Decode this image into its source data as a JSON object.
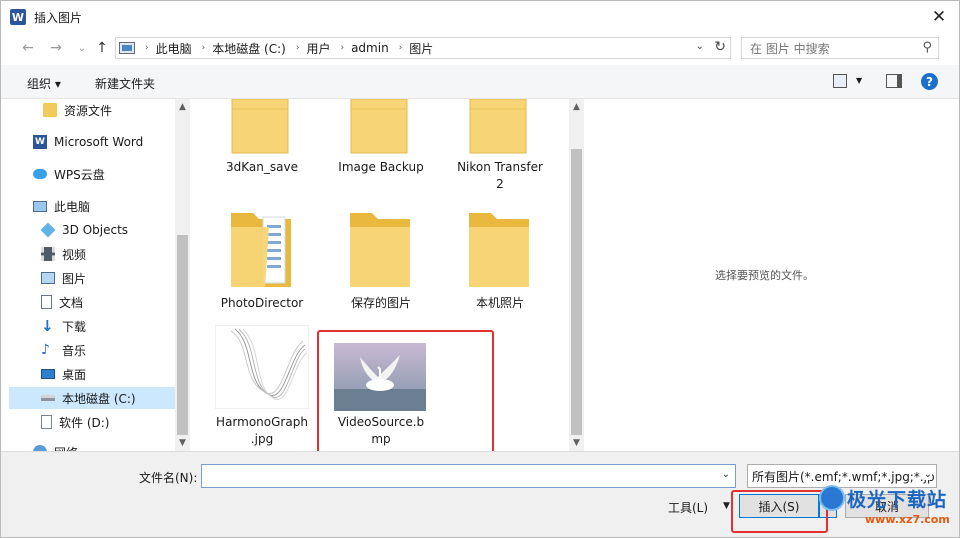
{
  "window": {
    "title": "插入图片",
    "app_icon_letter": "W"
  },
  "address": {
    "crumbs": [
      "此电脑",
      "本地磁盘 (C:)",
      "用户",
      "admin",
      "图片"
    ],
    "search_placeholder": "在 图片 中搜索"
  },
  "toolbar": {
    "organize": "组织 ▾",
    "new_folder": "新建文件夹"
  },
  "sidebar": {
    "items": [
      {
        "label": "资源文件",
        "icon": "folder-icon"
      },
      {
        "label": "Microsoft Word",
        "icon": "word-icon"
      },
      {
        "label": "WPS云盘",
        "icon": "cloud-icon"
      },
      {
        "label": "此电脑",
        "icon": "computer-icon"
      },
      {
        "label": "3D Objects",
        "icon": "cube-icon"
      },
      {
        "label": "视频",
        "icon": "video-icon"
      },
      {
        "label": "图片",
        "icon": "pictures-icon"
      },
      {
        "label": "文档",
        "icon": "document-icon"
      },
      {
        "label": "下载",
        "icon": "download-icon"
      },
      {
        "label": "音乐",
        "icon": "music-icon"
      },
      {
        "label": "桌面",
        "icon": "desktop-icon"
      },
      {
        "label": "本地磁盘 (C:)",
        "icon": "drive-icon",
        "selected": true
      },
      {
        "label": "软件 (D:)",
        "icon": "drive-icon"
      },
      {
        "label": "网络",
        "icon": "network-icon"
      }
    ]
  },
  "files": [
    {
      "line1": "3dKan_save",
      "line2": "",
      "type": "folder"
    },
    {
      "line1": "Image Backup",
      "line2": "",
      "type": "folder"
    },
    {
      "line1": "Nikon Transfer",
      "line2": "2",
      "type": "folder"
    },
    {
      "line1": "PhotoDirector",
      "line2": "",
      "type": "folder-docs"
    },
    {
      "line1": "保存的图片",
      "line2": "",
      "type": "folder"
    },
    {
      "line1": "本机照片",
      "line2": "",
      "type": "folder"
    },
    {
      "line1": "HarmonoGraph",
      "line2": ".jpg",
      "type": "image-graph"
    },
    {
      "line1": "VideoSource.b",
      "line2": "mp",
      "type": "image-swan",
      "highlighted": true
    }
  ],
  "preview": {
    "text": "选择要预览的文件。"
  },
  "bottom": {
    "filename_label": "文件名(N):",
    "filename_value": "",
    "filter_value": "所有图片(*.emf;*.wmf;*.jpg;*.jp",
    "tools_label": "工具(L)",
    "insert_label": "插入(S)",
    "cancel_label": "取消"
  },
  "watermark": {
    "brand": "极光下载站",
    "url": "www.xz7.com"
  },
  "colors": {
    "highlight_red": "#e33030",
    "selection_blue": "#cce8ff",
    "folder_yellow": "#f7d577"
  }
}
